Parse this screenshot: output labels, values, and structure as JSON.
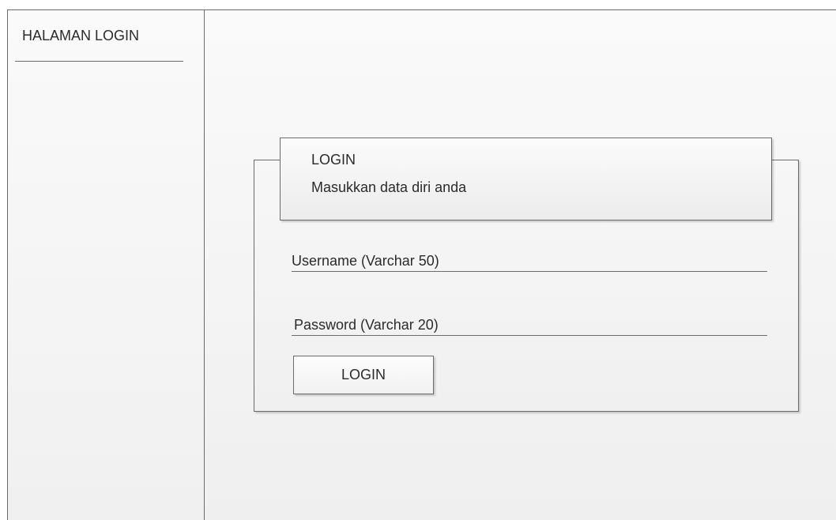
{
  "sidebar": {
    "title": "HALAMAN LOGIN"
  },
  "login_panel": {
    "title": "LOGIN",
    "subtitle": "Masukkan data diri anda"
  },
  "form": {
    "username_label": "Username (Varchar 50)",
    "password_label": "Password (Varchar 20)",
    "submit_label": "LOGIN"
  }
}
